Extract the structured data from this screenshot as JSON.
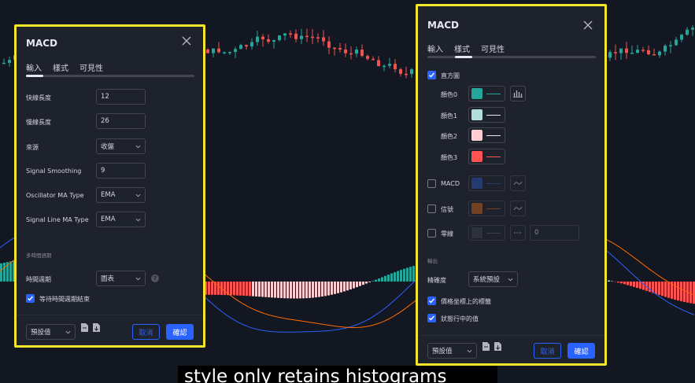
{
  "colors": {
    "background": "#131722",
    "dialog_bg": "#1e222d",
    "highlight_border": "#f5e62b",
    "accent": "#2962ff",
    "candle_up": "#26a69a",
    "candle_down": "#ef5350",
    "macd_line": "#2962ff",
    "signal_line": "#ff6d00"
  },
  "left_dialog": {
    "title": "MACD",
    "tabs": [
      "輸入",
      "樣式",
      "可見性"
    ],
    "active_tab": 0,
    "fields": [
      {
        "label": "快線長度",
        "value": "12",
        "kind": "input"
      },
      {
        "label": "慢線長度",
        "value": "26",
        "kind": "input"
      },
      {
        "label": "來源",
        "value": "收盤",
        "kind": "select"
      },
      {
        "label": "Signal Smoothing",
        "value": "9",
        "kind": "input"
      },
      {
        "label": "Oscillator MA Type",
        "value": "EMA",
        "kind": "select"
      },
      {
        "label": "Signal Line MA Type",
        "value": "EMA",
        "kind": "select"
      }
    ],
    "section_timeframe": "多時間週期",
    "timeframe_label": "時間週期",
    "timeframe_value": "圖表",
    "wait_label": "等待時間週期結束",
    "defaults_label": "預設值",
    "cancel_label": "取消",
    "ok_label": "確認"
  },
  "right_dialog": {
    "title": "MACD",
    "tabs": [
      "輸入",
      "樣式",
      "可見性"
    ],
    "active_tab": 1,
    "histogram_label": "直方圖",
    "colors": [
      {
        "label": "顏色0",
        "swatch": "#26a69a",
        "line": "#26a69a"
      },
      {
        "label": "顏色1",
        "swatch": "#b2dfdb",
        "line": "#e6e8ee"
      },
      {
        "label": "顏色2",
        "swatch": "#ffcdd2",
        "line": "#e6e8ee"
      },
      {
        "label": "顏色3",
        "swatch": "#ff5252",
        "line": "#ff5252"
      }
    ],
    "plots": [
      {
        "label": "MACD",
        "swatch": "#2a4a9e",
        "checked": false
      },
      {
        "label": "信號",
        "swatch": "#a8561a",
        "checked": false
      },
      {
        "label": "零線",
        "swatch": "#3a3d47",
        "checked": false,
        "value": "0"
      }
    ],
    "section_output": "輸出",
    "precision_label": "精確度",
    "precision_value": "系統預設",
    "price_scale_label": "價格坐標上的標籤",
    "status_line_label": "狀態行中的值",
    "defaults_label": "預設值",
    "cancel_label": "取消",
    "ok_label": "確認"
  },
  "subtitle": "style only retains histograms"
}
